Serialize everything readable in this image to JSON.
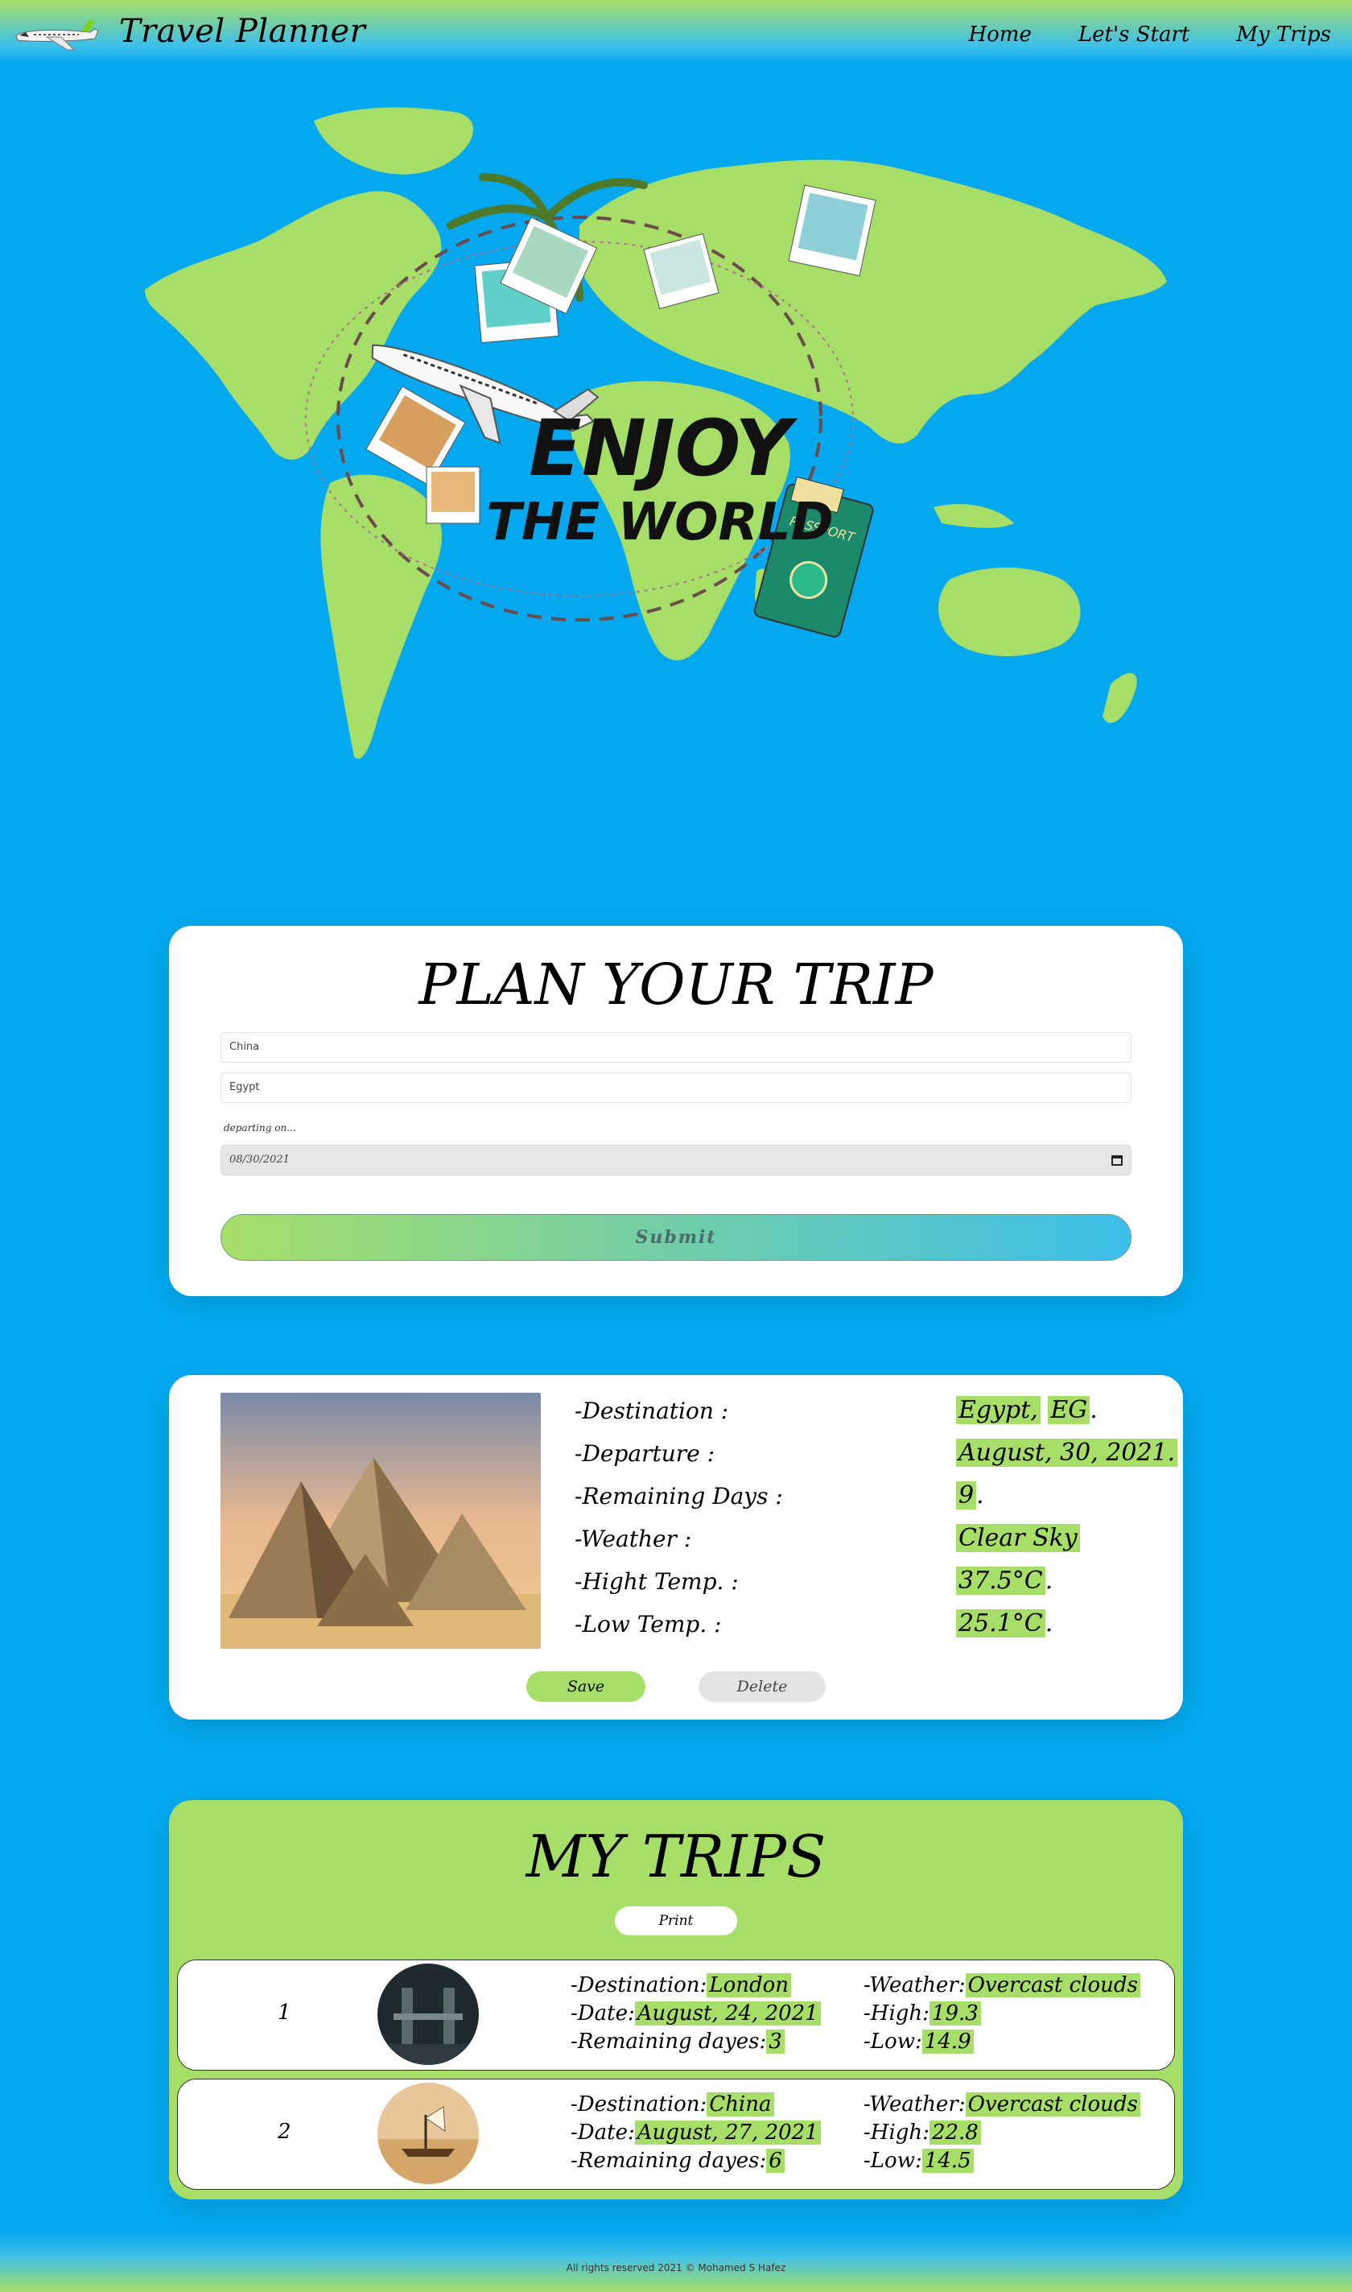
{
  "header": {
    "brand": "Travel Planner",
    "nav": [
      "Home",
      "Let's Start",
      "My Trips"
    ]
  },
  "hero": {
    "title_line1": "ENJOY",
    "title_line2": "THE WORLD",
    "passport_label": "PASSPORT"
  },
  "plan": {
    "title": "PLAN YOUR TRIP",
    "from_value": "China",
    "to_value": "Egypt",
    "departing_label": "departing on...",
    "date_value": "08/30/2021",
    "submit_label": "Submit"
  },
  "result": {
    "labels": [
      "-Destination :",
      "-Departure :",
      "-Remaining Days :",
      "-Weather :",
      "-Hight Temp. :",
      "-Low Temp. :"
    ],
    "destination_city": "Egypt,",
    "destination_code": "EG",
    "departure": "August, 30, 2021.",
    "remaining_days": "9",
    "weather": "Clear Sky",
    "high_temp": "37.5°C",
    "low_temp": "25.1°C",
    "suffix": ".",
    "save_label": "Save",
    "delete_label": "Delete"
  },
  "my_trips": {
    "title": "MY TRIPS",
    "print_label": "Print",
    "labels": {
      "destination": "-Destination:",
      "date": "-Date:",
      "remaining": "-Remaining dayes:",
      "weather": "-Weather:",
      "high": "-High:",
      "low": "-Low:"
    },
    "trips": [
      {
        "index": "1",
        "destination": "London",
        "date": "August, 24, 2021",
        "remaining": "3",
        "weather": "Overcast clouds",
        "high": "19.3",
        "low": "14.9"
      },
      {
        "index": "2",
        "destination": "China",
        "date": "August, 27, 2021",
        "remaining": "6",
        "weather": "Overcast clouds",
        "high": "22.8",
        "low": "14.5"
      }
    ]
  },
  "footer": {
    "text": "All rights reserved 2021 © Mohamed S Hafez"
  },
  "colors": {
    "background": "#04A8EF",
    "accent": "#A6DE68",
    "card": "#FFFFFF"
  }
}
